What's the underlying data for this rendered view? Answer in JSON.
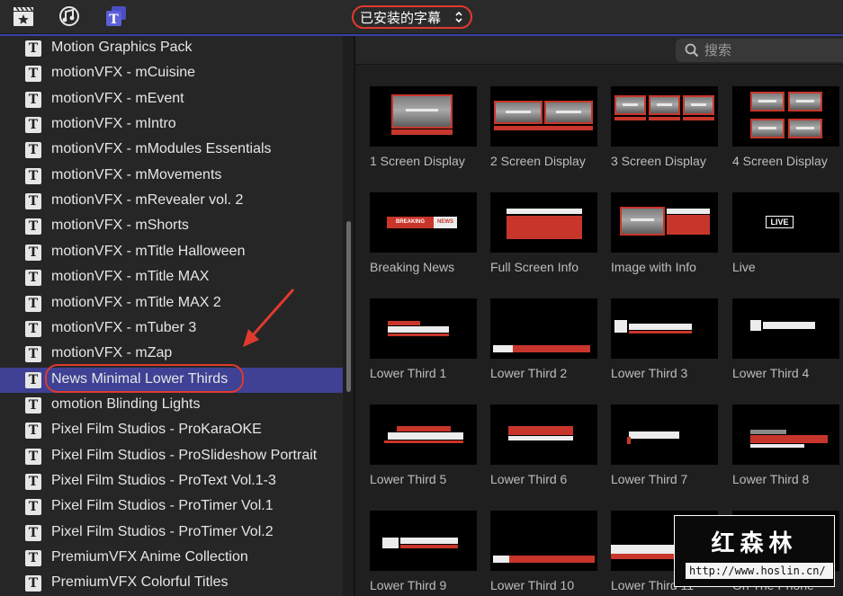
{
  "toolbar": {
    "icons": [
      "clapper-star-icon",
      "music-photos-icon",
      "titles-icon"
    ],
    "picker_label": "已安装的字幕"
  },
  "sidebar": {
    "items": [
      {
        "label": "Motion Graphics Pack"
      },
      {
        "label": "motionVFX - mCuisine"
      },
      {
        "label": "motionVFX - mEvent"
      },
      {
        "label": "motionVFX - mIntro"
      },
      {
        "label": "motionVFX - mModules Essentials"
      },
      {
        "label": "motionVFX - mMovements"
      },
      {
        "label": "motionVFX - mRevealer vol. 2"
      },
      {
        "label": "motionVFX - mShorts"
      },
      {
        "label": "motionVFX - mTitle Halloween"
      },
      {
        "label": "motionVFX - mTitle MAX"
      },
      {
        "label": "motionVFX - mTitle MAX 2"
      },
      {
        "label": "motionVFX - mTuber 3"
      },
      {
        "label": "motionVFX - mZap"
      },
      {
        "label": "News Minimal Lower Thirds",
        "selected": true
      },
      {
        "label": "omotion Blinding Lights"
      },
      {
        "label": "Pixel Film Studios - ProKaraOKE"
      },
      {
        "label": "Pixel Film Studios - ProSlideshow Portrait"
      },
      {
        "label": "Pixel Film Studios - ProText Vol.1-3"
      },
      {
        "label": "Pixel Film Studios - ProTimer Vol.1"
      },
      {
        "label": "Pixel Film Studios - ProTimer Vol.2"
      },
      {
        "label": "PremiumVFX Anime Collection"
      },
      {
        "label": "PremiumVFX Colorful Titles"
      }
    ]
  },
  "search": {
    "placeholder": "搜索"
  },
  "tiles": [
    {
      "label": "1 Screen Display"
    },
    {
      "label": "2 Screen Display"
    },
    {
      "label": "3 Screen Display"
    },
    {
      "label": "4 Screen Display"
    },
    {
      "label": "Breaking News"
    },
    {
      "label": "Full Screen Info"
    },
    {
      "label": "Image with Info"
    },
    {
      "label": "Live"
    },
    {
      "label": "Lower Third 1"
    },
    {
      "label": "Lower Third 2"
    },
    {
      "label": "Lower Third 3"
    },
    {
      "label": "Lower Third 4"
    },
    {
      "label": "Lower Third 5"
    },
    {
      "label": "Lower Third 6"
    },
    {
      "label": "Lower Third 7"
    },
    {
      "label": "Lower Third 8"
    },
    {
      "label": "Lower Third 9"
    },
    {
      "label": "Lower Third 10"
    },
    {
      "label": "Lower Third 11"
    },
    {
      "label": "On The Phone"
    }
  ],
  "thumb_text": {
    "breaking": "BREAKING",
    "news": "NEWS",
    "live": "LIVE"
  },
  "watermark": {
    "title": "红森林",
    "url": "http://www.hoslin.cn/"
  },
  "colors": {
    "accent_red": "#e03a2e",
    "selection_blue": "#3e4194"
  }
}
